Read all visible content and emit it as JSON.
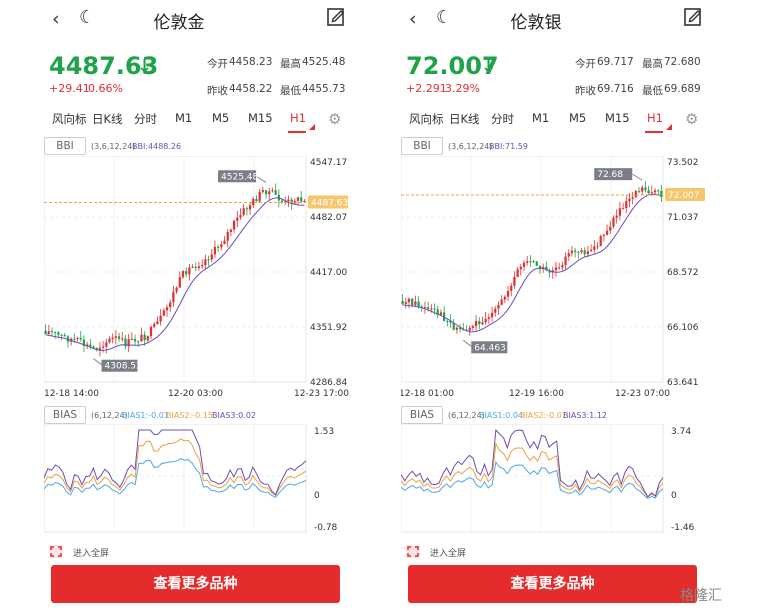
{
  "panels": [
    {
      "nav": {
        "back_icon": "chevron-left-icon",
        "theme_icon": "moon-icon",
        "title": "伦敦金",
        "edit_icon": "edit-icon"
      },
      "price": "4487.63",
      "price_arrow": "↓",
      "change": "+29.41",
      "change_pct": "0.66%",
      "stats": {
        "open_label": "今开",
        "open": "4458.23",
        "high_label": "最高",
        "high": "4525.48",
        "prev_label": "昨收",
        "prev": "4458.22",
        "low_label": "最低",
        "low": "4455.73"
      },
      "tabs": [
        "风向标",
        "日K线",
        "分时",
        "M1",
        "M5",
        "M15",
        "H1"
      ],
      "active_tab": "H1",
      "main_indicator": {
        "name": "BBI",
        "params": "(3,6,12,24)",
        "value_text": "BBI:4488.26"
      },
      "sub_indicator": {
        "name": "BIAS",
        "params": "(6,12,24)",
        "bias1": "BIAS1:-0.01",
        "bias2": "BIAS2:-0.15",
        "bias3": "BIAS3:0.02"
      },
      "price_axis": [
        "4547.17",
        "4482.07",
        "4417.00",
        "4351.92",
        "4286.84"
      ],
      "time_axis": [
        "12-18 14:00",
        "12-20 03:00",
        "12-23 17:00"
      ],
      "last_price_label": "4487.63",
      "high_marker": "4525.48",
      "low_marker": "4308.53",
      "bias_axis": [
        "1.53",
        "0",
        "-0.78"
      ],
      "fullscreen": "进入全屏",
      "more_button": "查看更多品种"
    },
    {
      "nav": {
        "back_icon": "chevron-left-icon",
        "theme_icon": "moon-icon",
        "title": "伦敦银",
        "edit_icon": "edit-icon"
      },
      "price": "72.007",
      "price_arrow": "↓",
      "change": "+2.291",
      "change_pct": "3.29%",
      "stats": {
        "open_label": "今开",
        "open": "69.717",
        "high_label": "最高",
        "high": "72.680",
        "prev_label": "昨收",
        "prev": "69.716",
        "low_label": "最低",
        "low": "69.689"
      },
      "tabs": [
        "风向标",
        "日K线",
        "分时",
        "M1",
        "M5",
        "M15",
        "H1"
      ],
      "active_tab": "H1",
      "main_indicator": {
        "name": "BBI",
        "params": "(3,6,12,24)",
        "value_text": "BBI:71.59"
      },
      "sub_indicator": {
        "name": "BIAS",
        "params": "(6,12,24)",
        "bias1": "BIAS1:0.04",
        "bias2": "BIAS2:-0.01",
        "bias3": "BIAS3:1.12"
      },
      "price_axis": [
        "73.502",
        "71.037",
        "68.572",
        "66.106",
        "63.641"
      ],
      "time_axis": [
        "12-18 01:00",
        "12-19 16:00",
        "12-23 07:00"
      ],
      "last_price_label": "72.007",
      "high_marker": "72.68",
      "low_marker": "64.463",
      "bias_axis": [
        "3.74",
        "0",
        "-1.46"
      ],
      "fullscreen": "进入全屏",
      "more_button": "查看更多品种"
    }
  ],
  "colors": {
    "up": "#e03131",
    "down": "#1fa34a",
    "bbi": "#6a4fb3",
    "bias1": "#4ea6e8",
    "bias2": "#f0a03c",
    "bias3": "#6a4fb3",
    "accent": "#e42c2c"
  },
  "watermark": "格隆汇"
}
